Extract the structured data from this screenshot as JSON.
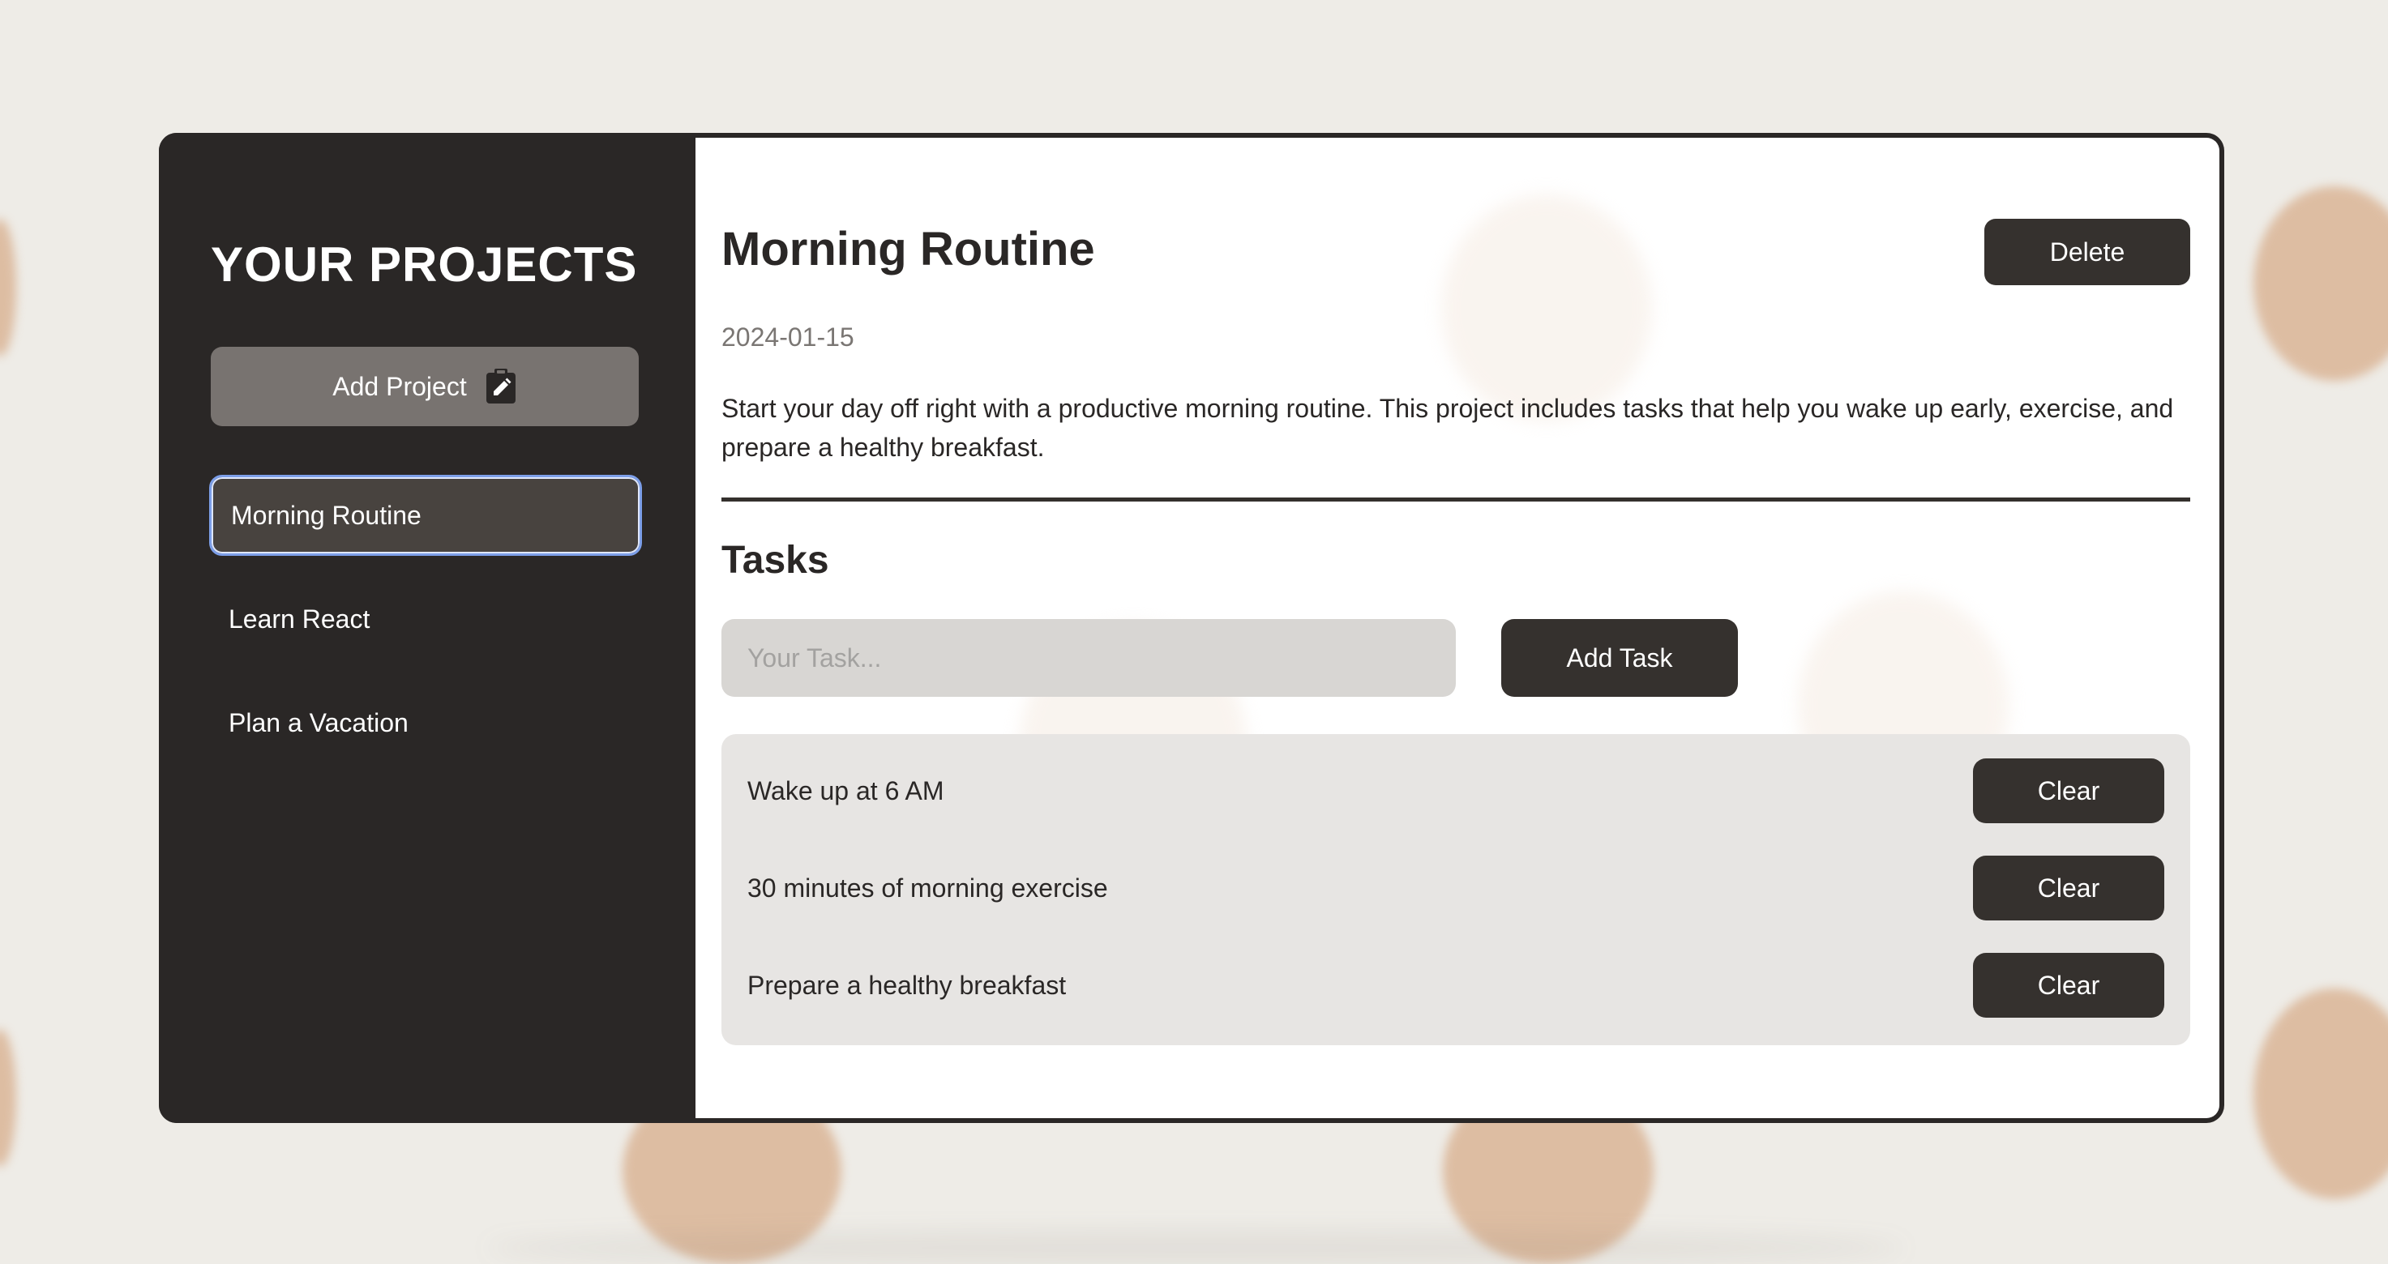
{
  "sidebar": {
    "title": "YOUR PROJECTS",
    "add_project_label": "Add Project",
    "add_project_icon": "clipboard-edit-icon",
    "projects": [
      {
        "label": "Morning Routine",
        "active": true
      },
      {
        "label": "Learn React",
        "active": false
      },
      {
        "label": "Plan a Vacation",
        "active": false
      }
    ]
  },
  "project": {
    "title": "Morning Routine",
    "delete_label": "Delete",
    "date": "2024-01-15",
    "description": "Start your day off right with a productive morning routine. This project includes tasks that help you wake up early, exercise, and prepare a healthy breakfast."
  },
  "tasks": {
    "title": "Tasks",
    "input_placeholder": "Your Task...",
    "input_value": "",
    "add_task_label": "Add Task",
    "items": [
      {
        "text": "Wake up at 6 AM",
        "action_label": "Clear"
      },
      {
        "text": "30 minutes of morning exercise",
        "action_label": "Clear"
      },
      {
        "text": "Prepare a healthy breakfast",
        "action_label": "Clear"
      }
    ]
  },
  "colors": {
    "background": "#eeece7",
    "sidebar": "#2a2726",
    "button_dark": "#35312e",
    "add_project_button": "#787370",
    "active_outline": "#7c9ee8",
    "task_panel": "#e7e5e3",
    "decor_dots": "#d8ae8c"
  }
}
